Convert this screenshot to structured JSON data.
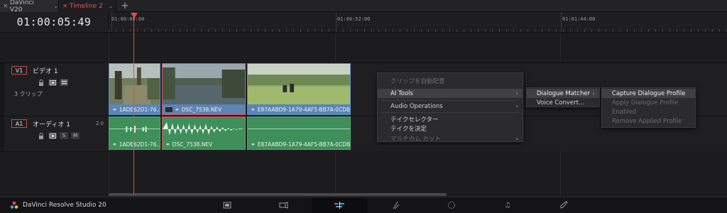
{
  "tabs": [
    {
      "label": "DaVinci V20",
      "close": "×",
      "chevron": "⌄"
    },
    {
      "label": "Timeline 2",
      "close": "×",
      "chevron": "⌄",
      "active": true
    }
  ],
  "add_tab": "+",
  "timecode": "01:00:05:49",
  "ruler": {
    "ticks": [
      "01:00:00:00",
      "01:00:52:00",
      "01:01:44:00"
    ]
  },
  "tracks": {
    "v1": {
      "id": "V1",
      "name": "ビデオ 1",
      "clip_count": "3 クリップ"
    },
    "a1": {
      "id": "A1",
      "name": "オーディオ 1",
      "level": "2.0",
      "solo": "S",
      "mute": "M"
    }
  },
  "video_clips": [
    {
      "name": "1ADE62D1-76..."
    },
    {
      "name": "DSC_7538.NEV"
    },
    {
      "name": "E87AABD9-1A79-4AF5-BB7A-0CDB1..."
    }
  ],
  "audio_clips": [
    {
      "name": "1ADE62D1-76..."
    },
    {
      "name": "DSC_7538.NEV"
    },
    {
      "name": "E87AABD9-1A79-4AF5-BB7A-0CDB1..."
    }
  ],
  "context_menu": {
    "items": [
      {
        "label": "クリップを自動配置",
        "disabled": true
      },
      {
        "label": "AI Tools",
        "highlighted": true,
        "submenu": "›"
      },
      {
        "label": "Audio Operations",
        "submenu": "›"
      },
      {
        "label": "テイクセレクター"
      },
      {
        "label": "テイクを決定"
      },
      {
        "label": "マルチカム カット",
        "disabled": true,
        "submenu": "›"
      }
    ]
  },
  "ai_submenu": {
    "items": [
      {
        "label": "Dialogue Matcher",
        "highlighted": true,
        "submenu": "›"
      },
      {
        "label": "Voice Convert..."
      }
    ]
  },
  "dialogue_submenu": {
    "items": [
      {
        "label": "Capture Dialogue Profile",
        "highlighted": true
      },
      {
        "label": "Apply Dialogue Profile",
        "disabled": true
      },
      {
        "label": "Enabled",
        "disabled": true
      },
      {
        "label": "Remove Applied Profile",
        "disabled": true
      }
    ]
  },
  "bottom": {
    "brand": "DaVinci Resolve Studio 20",
    "pages": [
      {
        "icon": "media-page-icon"
      },
      {
        "icon": "cut-page-icon"
      },
      {
        "icon": "edit-page-icon",
        "active": true
      },
      {
        "icon": "fusion-page-icon"
      },
      {
        "icon": "color-page-icon"
      },
      {
        "icon": "fairlight-page-icon"
      },
      {
        "icon": "deliver-page-icon"
      }
    ]
  },
  "colors": {
    "accent_red": "#e04848",
    "video_clip": "#5c84b6",
    "audio_clip": "#3e8f5a",
    "background": "#1c1c1f"
  }
}
